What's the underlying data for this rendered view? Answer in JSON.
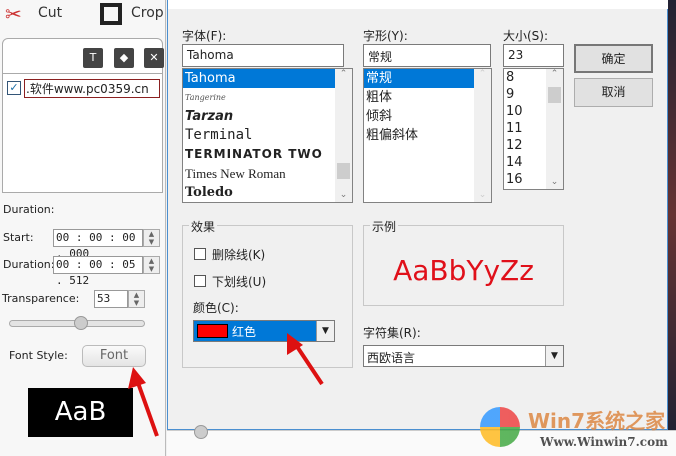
{
  "toolbar": {
    "cut": "Cut",
    "crop": "Crop"
  },
  "left": {
    "list_item": ".软件www.pc0359.cn",
    "duration_header": "Duration:",
    "start_label": "Start:",
    "start_value": "00 : 00 : 00 . 000",
    "duration_label": "Duration:",
    "duration_value": "00 : 00 : 05 . 512",
    "transparence_label": "Transparence:",
    "transparence_value": "53",
    "transparence_slider_fraction": 0.53,
    "font_style_label": "Font Style:",
    "font_button": "Font",
    "preview_text": "AaB"
  },
  "dialog": {
    "font_label": "字体(F):",
    "font_value": "Tahoma",
    "fonts": [
      "Tahoma",
      "Tangerine",
      "Tarzan",
      "Terminal",
      "TERMINATOR TWO",
      "Times New Roman",
      "Toledo"
    ],
    "style_label": "字形(Y):",
    "style_value": "常规",
    "styles": [
      "常规",
      "粗体",
      "倾斜",
      "粗偏斜体"
    ],
    "size_label": "大小(S):",
    "size_value": "23",
    "sizes": [
      "8",
      "9",
      "10",
      "11",
      "12",
      "14",
      "16"
    ],
    "ok": "确定",
    "cancel": "取消",
    "effects_label": "效果",
    "strike": "删除线(K)",
    "underline": "下划线(U)",
    "color_label": "颜色(C):",
    "color_value": "红色",
    "color_hex": "#ff0000",
    "sample_label": "示例",
    "sample_text": "AaBbYyZz",
    "charset_label": "字符集(R):",
    "charset_value": "西欧语言"
  },
  "watermark": {
    "brand": "Win7系统之家",
    "url": "Www.Winwin7.com"
  }
}
